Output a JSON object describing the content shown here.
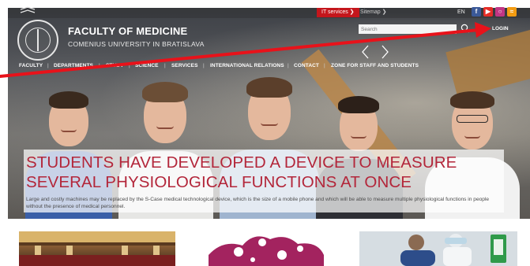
{
  "top_bar": {
    "it_services": "IT services",
    "sitemap": "Sitemap",
    "language": "EN",
    "social_icons": [
      "facebook-icon",
      "youtube-icon",
      "instagram-icon",
      "rss-icon"
    ]
  },
  "header": {
    "title": "FACULTY OF MEDICINE",
    "subtitle": "COMENIUS UNIVERSITY IN BRATISLAVA",
    "search_placeholder": "Search",
    "login": "LOGIN"
  },
  "nav": {
    "items": [
      {
        "label": "FACULTY"
      },
      {
        "label": "DEPARTMENTS"
      },
      {
        "label": "STUDY"
      },
      {
        "label": "SCIENCE"
      },
      {
        "label": "SERVICES"
      },
      {
        "label": "INTERNATIONAL RELATIONS"
      },
      {
        "label": "CONTACT"
      },
      {
        "label": "ZONE FOR STAFF AND STUDENTS"
      }
    ]
  },
  "hero": {
    "headline": "STUDENTS HAVE DEVELOPED A DEVICE TO MEASURE SEVERAL PHYSIOLOGICAL FUNCTIONS AT ONCE",
    "description": "Large and costly machines may be replaced by the S-Case medical technological device, which is the size of a mobile phone and which will be able to measure multiple physiological functions in people without the presence of medical personnel."
  },
  "colors": {
    "accent_red": "#c4161c",
    "headline_red": "#b3263a",
    "annotation_red": "#e8121a",
    "virus_magenta": "#a3235f"
  }
}
